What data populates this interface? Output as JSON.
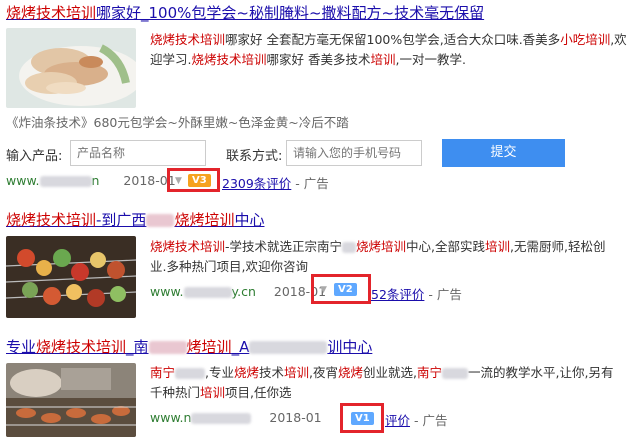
{
  "result1": {
    "title_a": "烧烤技术培训",
    "title_b": "哪家好_100%包学会~秘制腌料~撒料配方~技术毫无保留",
    "desc_a": "烧烤技术培训",
    "desc_b": "哪家好 全套配方毫无保留100%包学会,适合大众口味.香美多",
    "desc_c": "小吃培训",
    "desc_d": ",欢迎学习.",
    "desc_e": "烧烤技术培训",
    "desc_f": "哪家好 香美多技术",
    "desc_g": "培训",
    "desc_h": ",一对一教学.",
    "sublink": "《炸油条技术》680元包学会~外酥里嫩~色泽金黄~冷后不踏",
    "form": {
      "product_label": "输入产品:",
      "product_placeholder": "产品名称",
      "contact_label": "联系方式:",
      "contact_placeholder": "请输入您的手机号码",
      "submit": "提交"
    },
    "meta": {
      "url_start": "www.",
      "url_end": "n",
      "date": "2018-01",
      "badge": "V3",
      "reviews": "2309条评价",
      "ad": "- 广告"
    }
  },
  "result2": {
    "title_a": "烧烤技术培训",
    "title_b": "-到广西",
    "title_c": "烧烤培训",
    "title_d": "中心",
    "desc_a": "烧烤技术培训",
    "desc_b": "-学技术就选正宗南宁",
    "desc_c": "烧烤培训",
    "desc_d": "中心,全部实践",
    "desc_e": "培训",
    "desc_f": ",无需厨师,轻松创业.多种热门项目,欢迎你咨询",
    "meta": {
      "url_start": "www.",
      "url_end": "y.cn",
      "date": "2018-01",
      "badge": "V2",
      "reviews": "52条评价",
      "ad": "- 广告"
    }
  },
  "result3": {
    "title_a": "专业",
    "title_b": "烧烤技术培训",
    "title_c": "_南",
    "title_d": "烤培训",
    "title_e": "_A",
    "title_f": "训中心",
    "desc_a": "南宁",
    "desc_b": ",专业",
    "desc_c": "烧烤",
    "desc_d": "技术",
    "desc_e": "培训",
    "desc_f": ",夜宵",
    "desc_g": "烧烤",
    "desc_h": "创业就选,",
    "desc_i": "南宁",
    "desc_j": "一流的教学水平,让你,另有千种热门",
    "desc_k": "培训",
    "desc_l": "项目,任你选",
    "meta": {
      "url_start": "www.n",
      "date": "2018-01",
      "badge": "V1",
      "reviews": "评价",
      "ad": "- 广告"
    }
  }
}
